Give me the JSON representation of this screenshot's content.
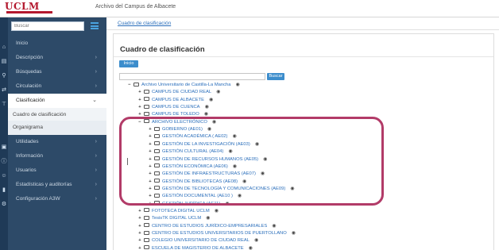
{
  "header": {
    "logo_text": "UCLM",
    "app_title": "Archivo del Campus de Albacete"
  },
  "sidebar": {
    "search_placeholder": "Buscar",
    "items": [
      {
        "label": "Inicio",
        "icon": "home-icon",
        "chevron": false
      },
      {
        "label": "Descripción",
        "icon": "document-icon",
        "chevron": true
      },
      {
        "label": "Búsquedas",
        "icon": "search-icon",
        "chevron": true
      },
      {
        "label": "Circulación",
        "icon": "transfer-icon",
        "chevron": true
      },
      {
        "label": "Clasificación",
        "icon": "sitemap-icon",
        "chevron": true,
        "active": true
      },
      {
        "label": "Cuadro de clasificación",
        "sub": true
      },
      {
        "label": "Organigrama",
        "plain": true
      },
      {
        "label": "Utilidades",
        "icon": "briefcase-icon",
        "chevron": true
      },
      {
        "label": "Información",
        "icon": "info-icon",
        "chevron": true
      },
      {
        "label": "Usuarios",
        "icon": "users-icon",
        "chevron": true
      },
      {
        "label": "Estadísticas y auditorías",
        "icon": "bar-chart-icon",
        "chevron": true
      },
      {
        "label": "Configuración A3W",
        "icon": "settings-icon",
        "chevron": true
      }
    ]
  },
  "breadcrumb": "Cuadro de clasificación",
  "main": {
    "title": "Cuadro de clasificación",
    "inicio_button": "Inicio",
    "search_button": "Buscar",
    "search_value": ""
  },
  "tree": [
    {
      "label": "Archivo Universitario de Castilla-La Mancha",
      "exp": "−",
      "level": 0
    },
    {
      "label": "CAMPUS DE CIUDAD REAL",
      "exp": "+",
      "level": 1
    },
    {
      "label": "CAMPUS DE ALBACETE",
      "exp": "+",
      "level": 1
    },
    {
      "label": "CAMPUS DE CUENCA",
      "exp": "+",
      "level": 1
    },
    {
      "label": "CAMPUS DE TOLEDO",
      "exp": "+",
      "level": 1
    },
    {
      "label": "ARCHIVO ELECTRÓNICO",
      "exp": "−",
      "level": 1
    },
    {
      "label": "GOBIERNO (AE01)",
      "exp": "+",
      "level": 2
    },
    {
      "label": "GESTIÓN ACADÉMICA ( AE02)",
      "exp": "+",
      "level": 2
    },
    {
      "label": "GESTIÓN DE LA INVESTIGACIÓN (AE03)",
      "exp": "+",
      "level": 2
    },
    {
      "label": "GESTIÓN CULTURAL (AE04)",
      "exp": "+",
      "level": 2
    },
    {
      "label": "GESTIÓN DE RECURSOS HUMANOS (AE05)",
      "exp": "+",
      "level": 2
    },
    {
      "label": "GESTIÓN ECONÓMICA (AE06)",
      "exp": "+",
      "level": 2
    },
    {
      "label": "GESTIÓN DE INFRAESTRUCTURAS (AE07)",
      "exp": "+",
      "level": 2
    },
    {
      "label": "GESTIÓN DE BIBLIOTECAS (AE08)",
      "exp": "+",
      "level": 2
    },
    {
      "label": "GESTIÓN DE TECNOLOGÍA Y COMUNICACIONES (AE09)",
      "exp": "+",
      "level": 2
    },
    {
      "label": "GESTIÓN DOCUMENTAL (AE10 )",
      "exp": "+",
      "level": 2
    },
    {
      "label": "GESTIÓN JURÍDICA (AE11)",
      "exp": "+",
      "level": 2
    },
    {
      "label": "FOTOTECA DIGITAL UCLM",
      "exp": "+",
      "level": 1
    },
    {
      "label": "TesisTK DIGITAL UCLM",
      "exp": "+",
      "level": 1
    },
    {
      "label": "CENTRO DE ESTUDIOS JURÍDICO-EMPRESARIALES",
      "exp": "+",
      "level": 1
    },
    {
      "label": "CENTRO DE ESTUDIOS UNIVERSITARIOS DE PUERTOLLANO",
      "exp": "+",
      "level": 1
    },
    {
      "label": "COLEGIO UNIVERSITARIO DE CIUDAD REAL",
      "exp": "+",
      "level": 1
    },
    {
      "label": "ESCUELA DE MAGISTERIO DE ALBACETE",
      "exp": "+",
      "level": 1
    }
  ],
  "colors": {
    "sidebar": "#2d4a68",
    "accent": "#3c8dcc",
    "link": "#2a6ebb",
    "highlight": "#b23b68",
    "brand": "#b3182e"
  }
}
